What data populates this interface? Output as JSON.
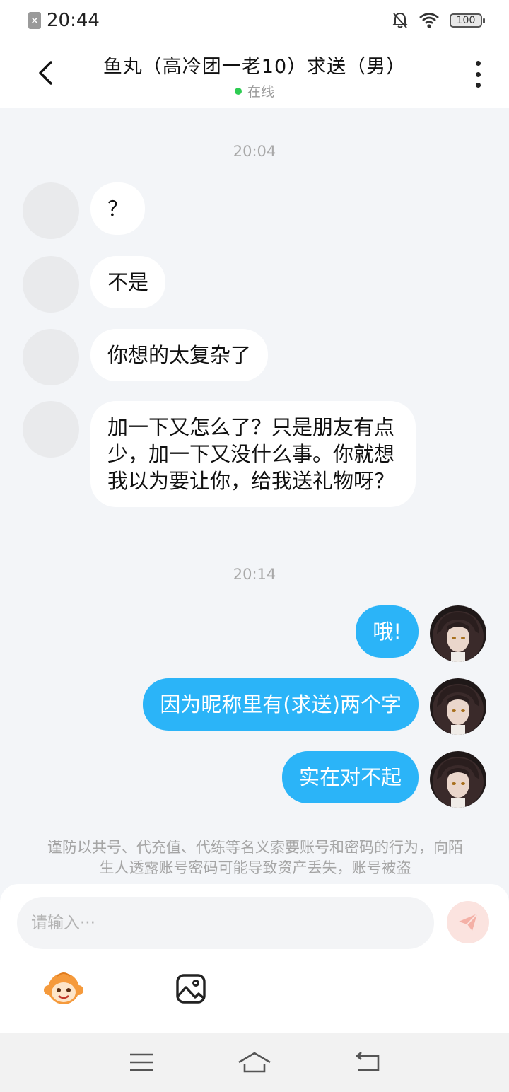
{
  "status_bar": {
    "time": "20:44",
    "battery": "100",
    "sim_icon": "sim-off-icon",
    "icons": [
      "bell-off-icon",
      "wifi-icon",
      "battery-icon"
    ]
  },
  "header": {
    "title": "鱼丸（高冷团一老10）求送（男）",
    "status": "在线",
    "status_color": "#2ecc52"
  },
  "chat": {
    "groups": [
      {
        "time": "20:04",
        "messages": [
          {
            "from": "other",
            "text": "？"
          },
          {
            "from": "other",
            "text": "不是"
          },
          {
            "from": "other",
            "text": "你想的太复杂了"
          },
          {
            "from": "other",
            "text": "加一下又怎么了？只是朋友有点少，加一下又没什么事。你就想我以为要让你，给我送礼物呀？"
          }
        ]
      },
      {
        "time": "20:14",
        "messages": [
          {
            "from": "me",
            "text": "哦!"
          },
          {
            "from": "me",
            "text": "因为昵称里有(求送)两个字"
          },
          {
            "from": "me",
            "text": "实在对不起"
          }
        ]
      }
    ],
    "notice": "谨防以共号、代充值、代练等名义索要账号和密码的行为，向陌生人透露账号密码可能导致资产丢失，账号被盗"
  },
  "input": {
    "placeholder": "请输入···",
    "value": ""
  },
  "toolbar": {
    "emoji_icon": "monkey-emoji-icon",
    "image_icon": "image-icon",
    "send_icon": "send-icon"
  },
  "colors": {
    "accent": "#2bb4f8",
    "send_disabled": "#fbe3df"
  },
  "nav": [
    "menu-icon",
    "home-icon",
    "back-icon"
  ]
}
